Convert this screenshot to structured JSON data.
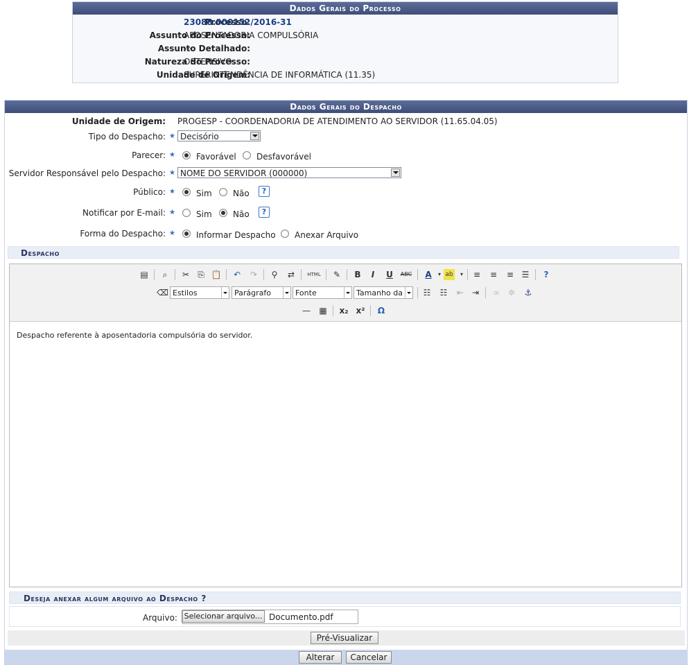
{
  "processo": {
    "title": "Dados Gerais do Processo",
    "fields": [
      {
        "label": "Processo:",
        "value": "23088.000152/2016-31"
      },
      {
        "label": "Assunto do Processo:",
        "value": "APOSENTADORIA COMPULSÓRIA"
      },
      {
        "label": "Assunto Detalhado:",
        "value": "---"
      },
      {
        "label": "Natureza do Processo:",
        "value": "OSTENSIVO"
      },
      {
        "label": "Unidade de Origem:",
        "value": "SUPERINTENDÊNCIA DE INFORMÁTICA (11.35)"
      }
    ]
  },
  "despacho": {
    "title": "Dados Gerais do Despacho",
    "unidade_label": "Unidade de Origem:",
    "unidade_value": "PROGESP - COORDENADORIA DE ATENDIMENTO AO SERVIDOR (11.65.04.05)",
    "tipo_label": "Tipo do Despacho:",
    "tipo_value": "Decisório",
    "parecer_label": "Parecer:",
    "parecer_options": [
      "Favorável",
      "Desfavorável"
    ],
    "parecer_selected": "Favorável",
    "servidor_label": "Servidor Responsável pelo Despacho:",
    "servidor_value": "NOME DO SERVIDOR (000000)",
    "publico_label": "Público:",
    "publico_options": [
      "Sim",
      "Não"
    ],
    "publico_selected": "Sim",
    "notificar_label": "Notificar por E-mail:",
    "notificar_options": [
      "Sim",
      "Não"
    ],
    "notificar_selected": "Não",
    "forma_label": "Forma do Despacho:",
    "forma_options": [
      "Informar Despacho",
      "Anexar Arquivo"
    ],
    "forma_selected": "Informar Despacho",
    "help_glyph": "?",
    "required_glyph": "★"
  },
  "editor": {
    "section_title": "Despacho",
    "styles_select": "Estilos",
    "paragraph_select": "Parágrafo",
    "font_select": "Fonte",
    "size_select": "Tamanho da Fo",
    "content": "Despacho referente à aposentadoria compulsória do servidor."
  },
  "anexo": {
    "section_title": "Deseja anexar algum arquivo ao Despacho ?",
    "arquivo_label": "Arquivo:",
    "select_button": "Selecionar arquivo...",
    "filename": "Documento.pdf"
  },
  "buttons": {
    "preview": "Pré-Visualizar",
    "alterar": "Alterar",
    "cancelar": "Cancelar"
  }
}
